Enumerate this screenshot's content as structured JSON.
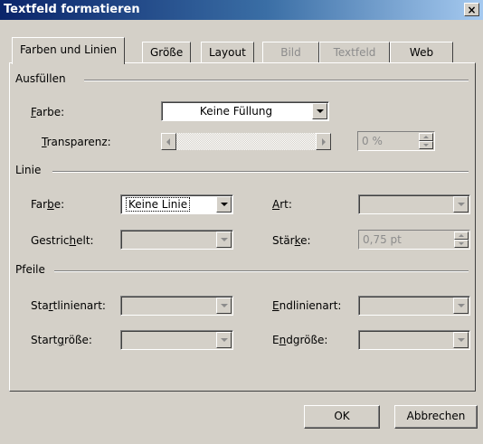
{
  "window": {
    "title": "Textfeld formatieren",
    "close_label": "×"
  },
  "tabs": [
    {
      "label": "Farben und Linien",
      "active": true,
      "enabled": true
    },
    {
      "label": "Größe",
      "active": false,
      "enabled": true
    },
    {
      "label": "Layout",
      "active": false,
      "enabled": true
    },
    {
      "label": "Bild",
      "active": false,
      "enabled": false
    },
    {
      "label": "Textfeld",
      "active": false,
      "enabled": false
    },
    {
      "label": "Web",
      "active": false,
      "enabled": true
    }
  ],
  "fill": {
    "heading": "Ausfüllen",
    "color_label_mnemonic": "F",
    "color_label_rest": "arbe:",
    "color_value": "Keine Füllung",
    "transparency_label_mnemonic": "T",
    "transparency_label_rest": "ransparenz:",
    "transparency_value": "0 %"
  },
  "line": {
    "heading": "Linie",
    "color_label_pre": "Far",
    "color_label_mnemonic": "b",
    "color_label_post": "e:",
    "color_value": "Keine Linie",
    "dashed_label_pre": "Gestric",
    "dashed_label_mnemonic": "h",
    "dashed_label_post": "elt:",
    "dashed_value": "",
    "style_label_mnemonic": "A",
    "style_label_rest": "rt:",
    "style_value": "",
    "weight_label_pre": "Stär",
    "weight_label_mnemonic": "k",
    "weight_label_post": "e:",
    "weight_value": "0,75 pt"
  },
  "arrows": {
    "heading": "Pfeile",
    "begin_style_label_pre": "Sta",
    "begin_style_label_mnemonic": "r",
    "begin_style_label_post": "tlinienart:",
    "begin_style_value": "",
    "end_style_label_mnemonic": "E",
    "end_style_label_rest": "ndlinienart:",
    "end_style_value": "",
    "begin_size_label_pre": "Start",
    "begin_size_label_mnemonic": "g",
    "begin_size_label_post": "röße:",
    "begin_size_value": "",
    "end_size_label_pre": "E",
    "end_size_label_mnemonic": "n",
    "end_size_label_post": "dgröße:",
    "end_size_value": ""
  },
  "buttons": {
    "ok": "OK",
    "cancel": "Abbrechen"
  }
}
